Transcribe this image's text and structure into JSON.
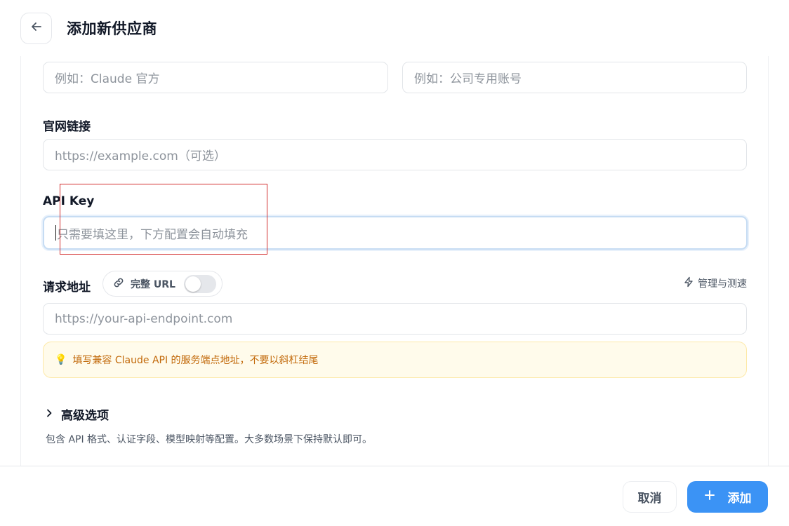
{
  "header": {
    "title": "添加新供应商"
  },
  "form": {
    "name_placeholder": "例如：Claude 官方",
    "note_placeholder": "例如：公司专用账号",
    "website_label": "官网链接",
    "website_placeholder": "https://example.com（可选）",
    "api_key_label": "API Key",
    "api_key_placeholder": "只需要填这里，下方配置会自动填充",
    "endpoint_label": "请求地址",
    "full_url_label": "完整 URL",
    "full_url_enabled": false,
    "manage_label": "管理与测速",
    "endpoint_placeholder": "https://your-api-endpoint.com",
    "hint_icon": "💡",
    "hint_text": "填写兼容 Claude API 的服务端点地址，不要以斜杠结尾",
    "advanced_label": "高级选项",
    "advanced_desc": "包含 API 格式、认证字段、模型映射等配置。大多数场景下保持默认即可。"
  },
  "footer": {
    "cancel_label": "取消",
    "add_label": "添加"
  },
  "colors": {
    "accent": "#3b93f5",
    "hint_bg": "#fffbeb",
    "hint_text": "#c2690a",
    "annotation": "#d32f2f"
  },
  "icons": {
    "back": "arrow-left-icon",
    "link": "link-icon",
    "manage": "lightning-icon",
    "advanced": "chevron-right-icon",
    "add": "plus-icon",
    "hint": "lightbulb-icon"
  }
}
